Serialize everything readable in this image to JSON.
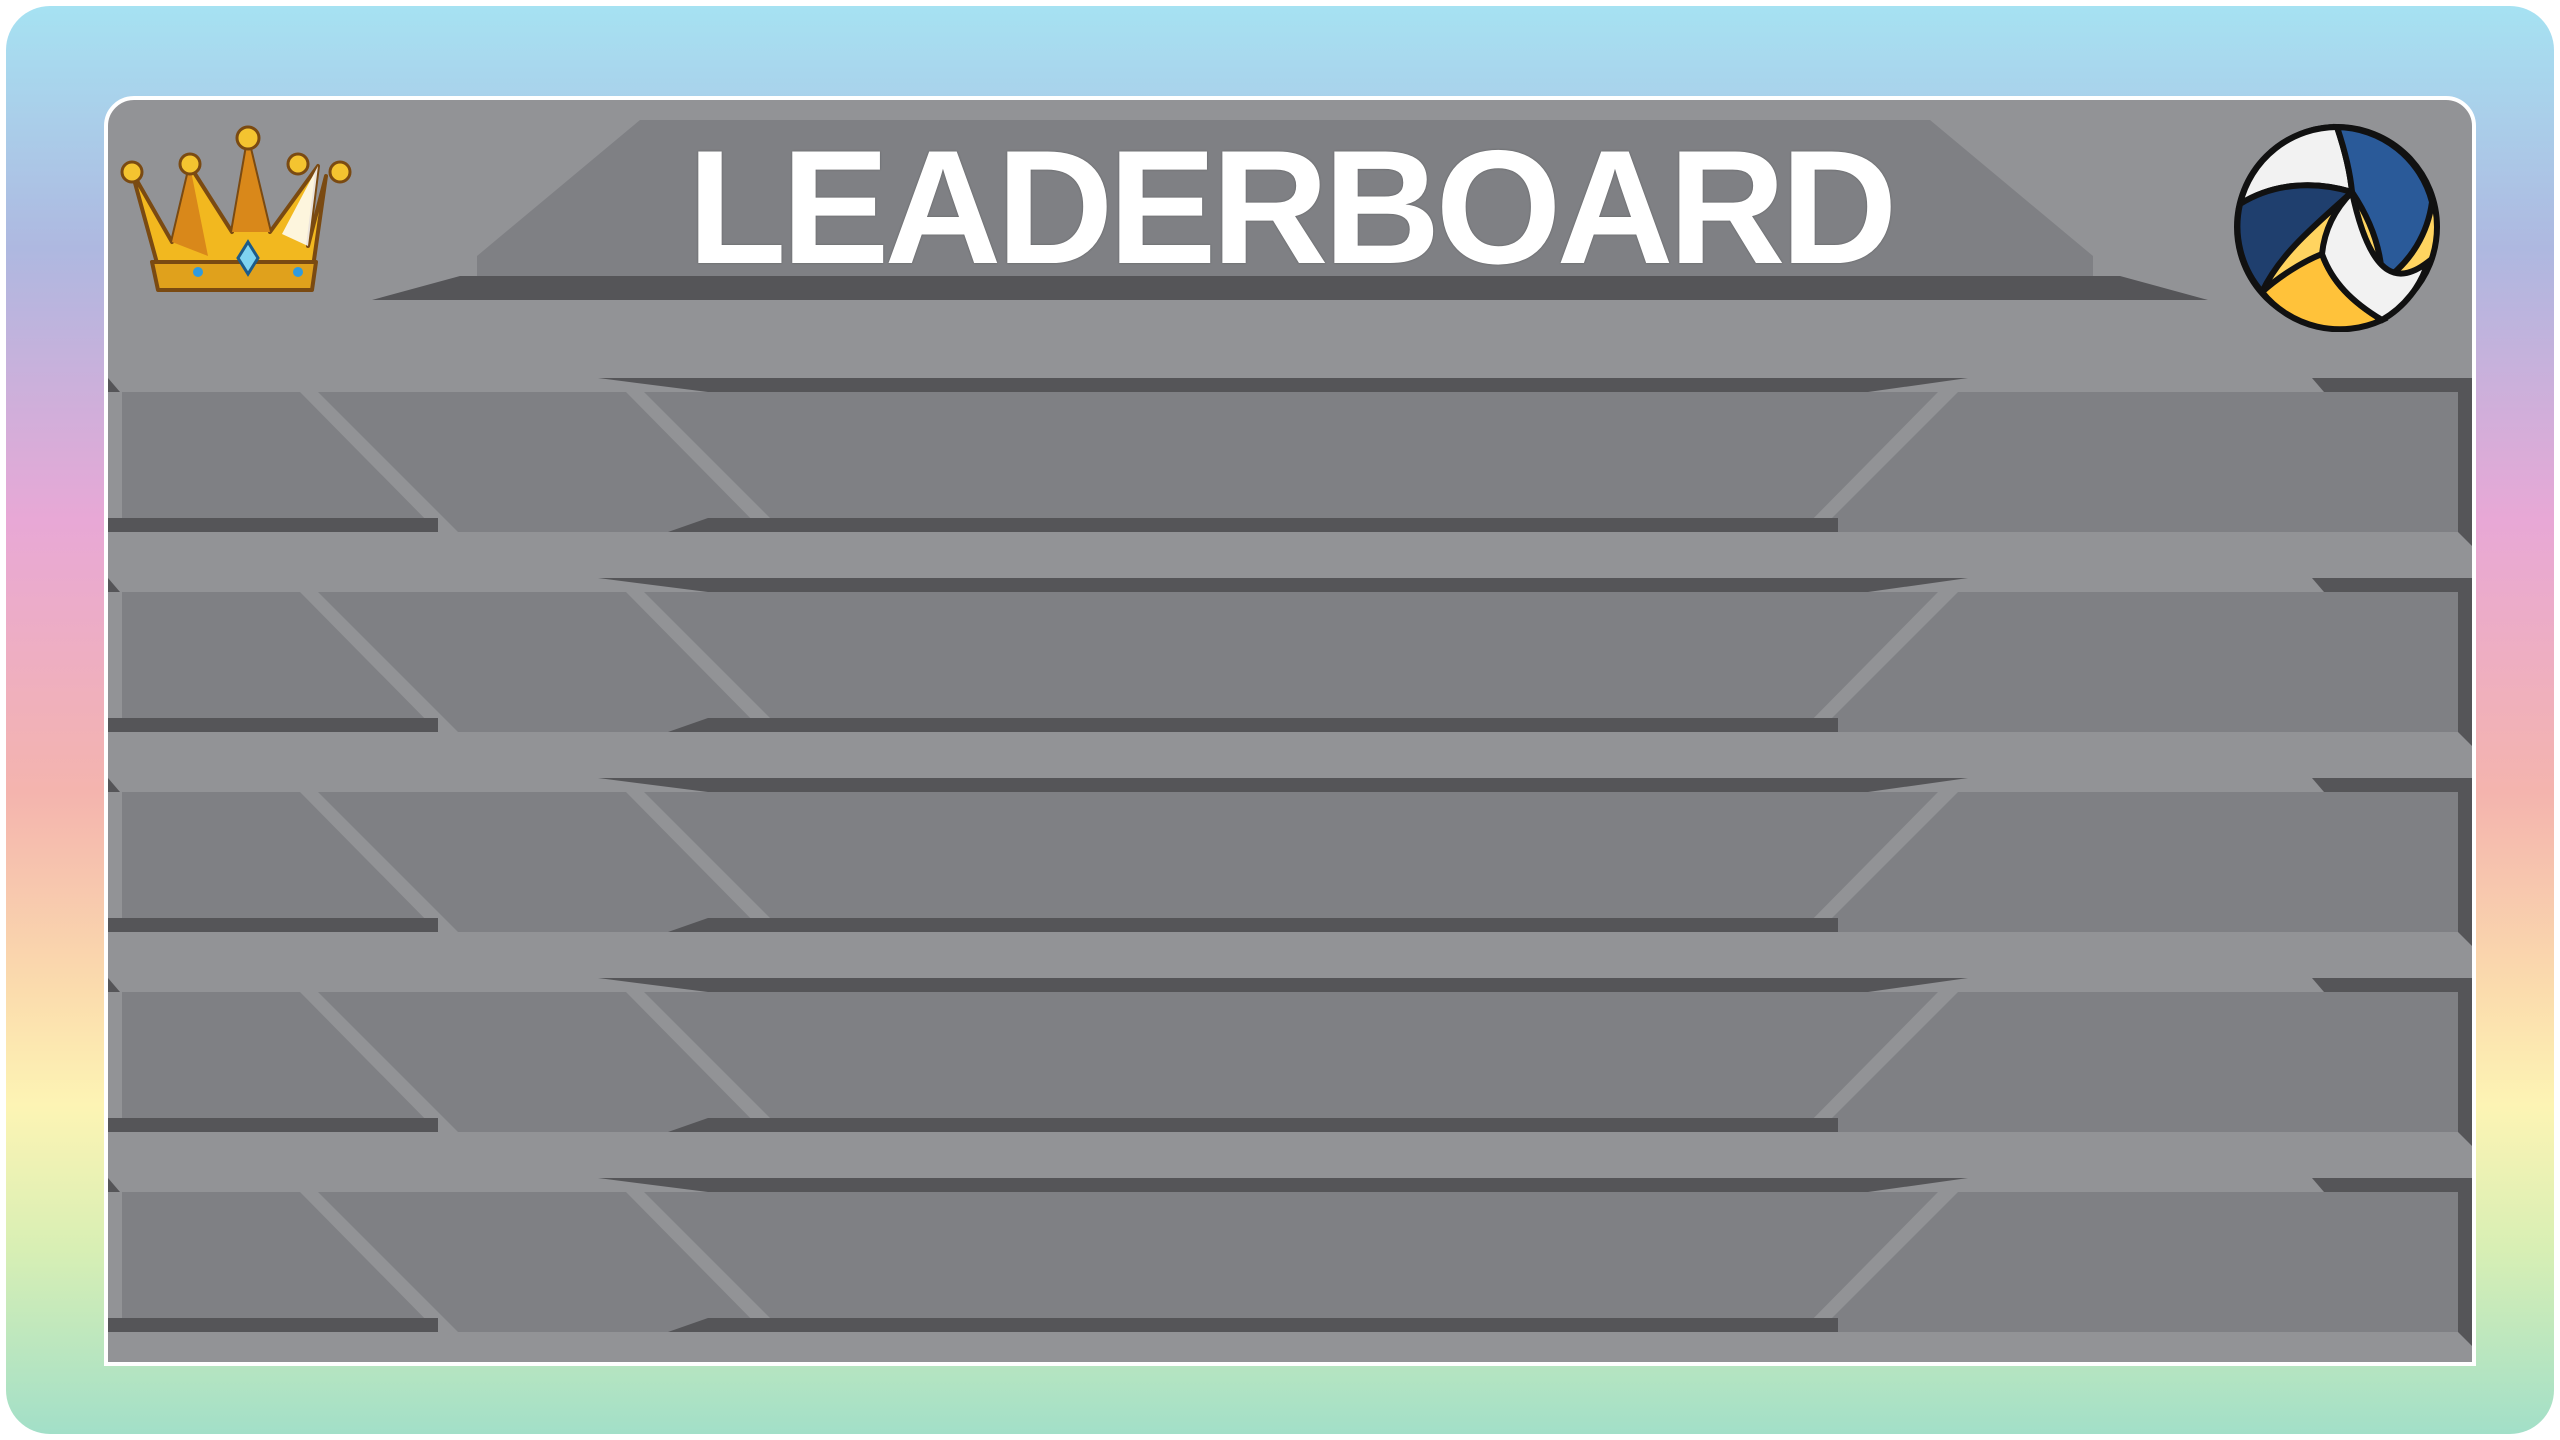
{
  "title": "LEADERBOARD",
  "icons": {
    "left": "crown-icon",
    "right": "volleyball-icon"
  },
  "colors": {
    "board": "#929396",
    "panel": "#7f8084",
    "shadow": "#555558",
    "text": "#ffffff"
  },
  "rows": [
    {
      "rank": "",
      "badge": "",
      "name": "",
      "score": ""
    },
    {
      "rank": "",
      "badge": "",
      "name": "",
      "score": ""
    },
    {
      "rank": "",
      "badge": "",
      "name": "",
      "score": ""
    },
    {
      "rank": "",
      "badge": "",
      "name": "",
      "score": ""
    },
    {
      "rank": "",
      "badge": "",
      "name": "",
      "score": ""
    }
  ]
}
